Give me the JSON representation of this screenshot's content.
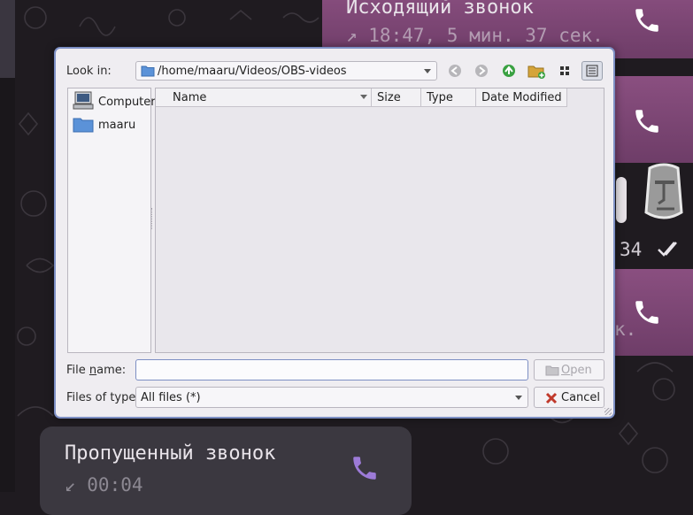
{
  "chat": {
    "outgoing_call_title": "Исходящий звонок",
    "outgoing_call_meta": "↗ 18:47, 5 мин. 37 сек.",
    "partial_time": "34",
    "partial_meta": "к.",
    "missed_call_title": "Пропущенный звонок",
    "missed_call_meta": "↙ 00:04"
  },
  "dialog": {
    "look_in_label": "Look in:",
    "look_in_path": "/home/maaru/Videos/OBS-videos",
    "places": [
      {
        "label": "Computer",
        "icon": "computer-icon"
      },
      {
        "label": "maaru",
        "icon": "folder-icon"
      }
    ],
    "columns": [
      "Name",
      "Size",
      "Type",
      "Date Modified"
    ],
    "file_name_label_pre": "File ",
    "file_name_label_mn": "n",
    "file_name_label_post": "ame:",
    "file_name_value": "",
    "files_of_type_label": "Files of type:",
    "files_of_type_value": "All files (*)",
    "open_label_mn": "O",
    "open_label_rest": "pen",
    "cancel_label": "Cancel"
  },
  "colors": {
    "bubble": "#7c4574",
    "dialog_bg": "#efedf1",
    "accent": "#7d8fc4"
  }
}
